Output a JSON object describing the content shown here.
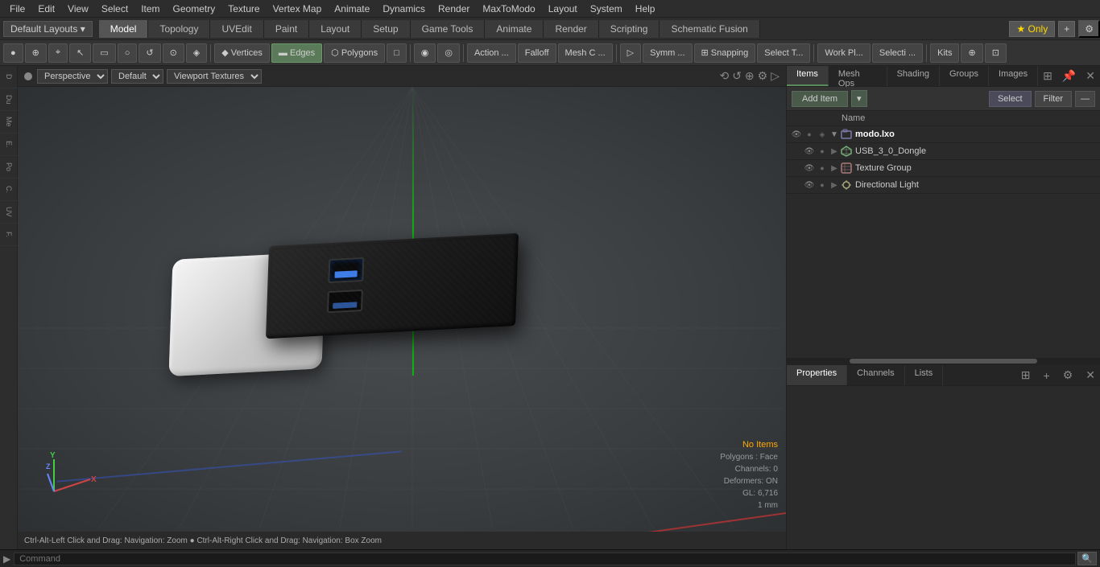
{
  "menu": {
    "items": [
      "File",
      "Edit",
      "View",
      "Select",
      "Item",
      "Geometry",
      "Texture",
      "Vertex Map",
      "Animate",
      "Dynamics",
      "Render",
      "MaxToModo",
      "Layout",
      "System",
      "Help"
    ]
  },
  "layout_bar": {
    "dropdown": "Default Layouts ▾",
    "tabs": [
      "Model",
      "Topology",
      "UVEdit",
      "Paint",
      "Layout",
      "Setup",
      "Game Tools",
      "Animate",
      "Render",
      "Scripting",
      "Schematic Fusion"
    ],
    "active_tab": "Model",
    "star_label": "★ Only",
    "plus_label": "+",
    "gear_label": "⚙"
  },
  "tool_bar": {
    "items": [
      {
        "label": "●",
        "type": "dot"
      },
      {
        "label": "⊕",
        "type": "btn"
      },
      {
        "label": "⌖",
        "type": "btn"
      },
      {
        "label": "↖",
        "type": "btn"
      },
      {
        "label": "▭▭",
        "type": "btn"
      },
      {
        "label": "○",
        "type": "btn"
      },
      {
        "label": "↺",
        "type": "btn"
      },
      {
        "label": "⊙",
        "type": "btn"
      },
      {
        "label": "◈",
        "type": "btn"
      },
      {
        "sep": true
      },
      {
        "label": "◆ Vertices",
        "type": "btn"
      },
      {
        "label": "▬ Edges",
        "type": "btn",
        "active": true
      },
      {
        "label": "⬡ Polygons",
        "type": "btn"
      },
      {
        "label": "□",
        "type": "btn"
      },
      {
        "sep": true
      },
      {
        "label": "◉",
        "type": "btn"
      },
      {
        "label": "◎",
        "type": "btn"
      },
      {
        "sep": true
      },
      {
        "label": "Action ...",
        "type": "btn"
      },
      {
        "label": "Falloff",
        "type": "btn"
      },
      {
        "label": "Mesh C ...",
        "type": "btn"
      },
      {
        "sep": true
      },
      {
        "label": "▷",
        "type": "btn"
      },
      {
        "label": "Symm ...",
        "type": "btn"
      },
      {
        "label": "⊞ Snapping",
        "type": "btn"
      },
      {
        "label": "Select T...",
        "type": "btn"
      },
      {
        "sep": true
      },
      {
        "label": "Work Pl...",
        "type": "btn"
      },
      {
        "label": "Selecti ...",
        "type": "btn"
      },
      {
        "sep": true
      },
      {
        "label": "Kits",
        "type": "btn"
      },
      {
        "label": "⊕",
        "type": "btn"
      },
      {
        "label": "⊡",
        "type": "btn"
      }
    ]
  },
  "left_sidebar": {
    "items": [
      "D",
      "Du",
      "Me",
      "E.",
      "Po",
      "C.",
      "UV",
      "F."
    ]
  },
  "viewport": {
    "dot_color": "#666",
    "camera": "Perspective",
    "shading": "Default",
    "textures": "Viewport Textures",
    "icons": [
      "⟲",
      "↺",
      "⊕",
      "⚙",
      "▷"
    ]
  },
  "scene_status": {
    "items_label": "No Items",
    "polygons": "Polygons : Face",
    "channels": "Channels: 0",
    "deformers": "Deformers: ON",
    "gl": "GL: 6,716",
    "scale": "1 mm"
  },
  "bottom_status": {
    "text": "Ctrl-Alt-Left Click and Drag: Navigation: Zoom ● Ctrl-Alt-Right Click and Drag: Navigation: Box Zoom"
  },
  "right_panel": {
    "top_tabs": [
      "Items",
      "Mesh Ops",
      "Shading",
      "Groups",
      "Images"
    ],
    "active_top_tab": "Items",
    "add_item_label": "Add Item",
    "select_label": "Select",
    "filter_label": "Filter",
    "name_column": "Name",
    "items": [
      {
        "id": "modo_lxo",
        "label": "modo.lxo",
        "type": "root",
        "indent": 0,
        "expanded": true,
        "icon": "group"
      },
      {
        "id": "usb_dongle",
        "label": "USB_3_0_Dongle",
        "type": "mesh",
        "indent": 1,
        "expanded": false,
        "icon": "mesh"
      },
      {
        "id": "texture_group",
        "label": "Texture Group",
        "type": "texture",
        "indent": 1,
        "expanded": false,
        "icon": "texture"
      },
      {
        "id": "directional_light",
        "label": "Directional Light",
        "type": "light",
        "indent": 1,
        "expanded": false,
        "icon": "light"
      }
    ]
  },
  "properties_panel": {
    "tabs": [
      "Properties",
      "Channels",
      "Lists"
    ],
    "active_tab": "Properties",
    "plus_label": "+"
  },
  "command_bar": {
    "placeholder": "Command",
    "search_label": "🔍"
  }
}
